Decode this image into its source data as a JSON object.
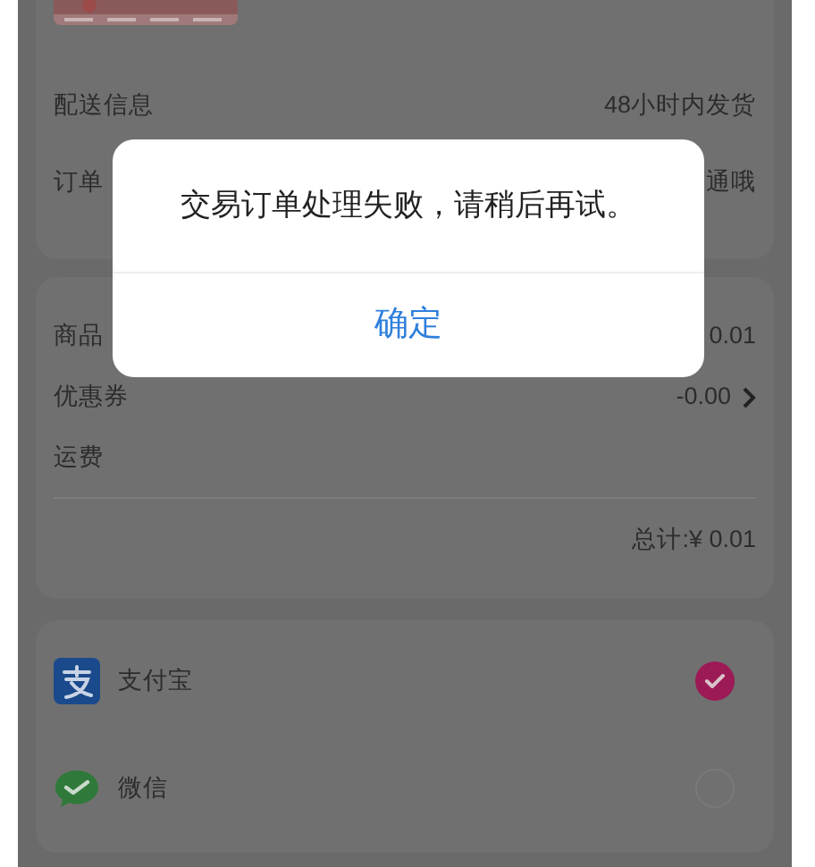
{
  "order_info": [
    {
      "label": "配送信息",
      "value": "48小时内发货"
    },
    {
      "label": "订单",
      "value": "通哦"
    }
  ],
  "price_rows": [
    {
      "label": "商品",
      "value": "0.01",
      "chevron": false
    },
    {
      "label": "优惠券",
      "value": "-0.00",
      "chevron": true
    },
    {
      "label": "运费",
      "chevron": false
    }
  ],
  "total": "总计:¥ 0.01",
  "payment_methods": [
    {
      "name": "支付宝",
      "kind": "alipay",
      "selected": true
    },
    {
      "name": "微信",
      "kind": "wechat",
      "selected": false
    }
  ],
  "dialog": {
    "message": "交易订单处理失败，请稍后再试。",
    "button": "确定"
  }
}
